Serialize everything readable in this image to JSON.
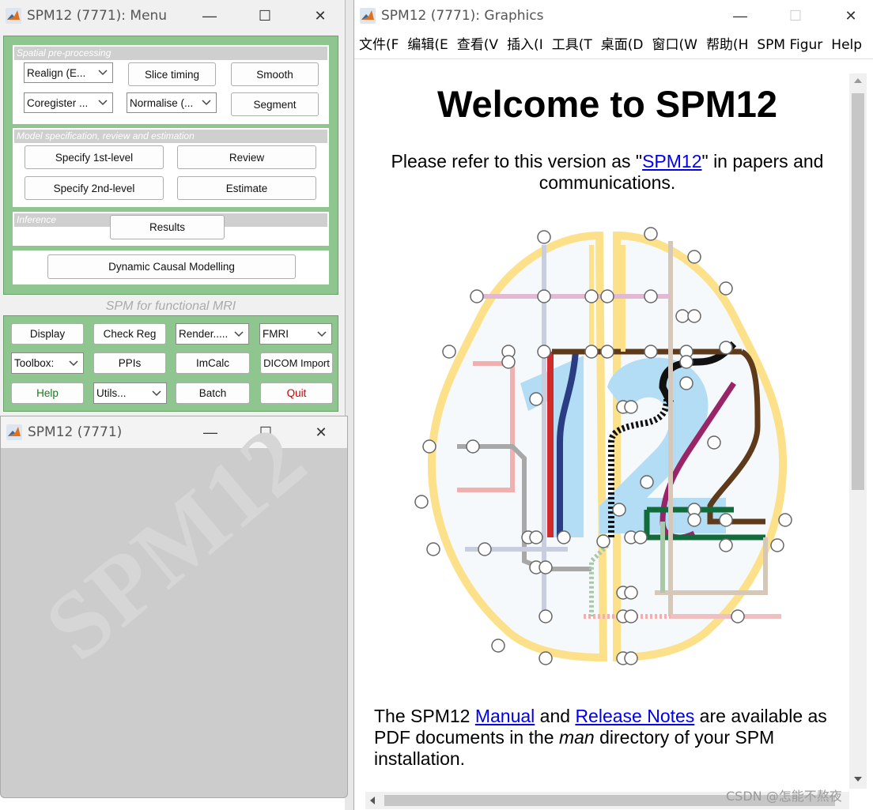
{
  "menu_window": {
    "title": "SPM12 (7771): Menu",
    "controls": {
      "minimize": "—",
      "maximize": "☐",
      "close": "✕"
    },
    "spatial_panel": {
      "label": "Spatial pre-processing",
      "realign": "Realign (E...",
      "slice_timing": "Slice timing",
      "smooth": "Smooth",
      "coregister": "Coregister ...",
      "normalise": "Normalise (...",
      "segment": "Segment"
    },
    "model_panel": {
      "label": "Model specification, review and estimation",
      "specify_1st": "Specify 1st-level",
      "review": "Review",
      "specify_2nd": "Specify 2nd-level",
      "estimate": "Estimate"
    },
    "inference_panel": {
      "label": "Inference",
      "results": "Results"
    },
    "dcm": "Dynamic Causal Modelling",
    "modality_caption": "SPM for functional MRI",
    "tools": {
      "display": "Display",
      "check_reg": "Check Reg",
      "render": "Render.....",
      "fmri": "FMRI",
      "toolbox": "Toolbox:",
      "ppis": "PPIs",
      "imcalc": "ImCalc",
      "dicom": "DICOM Import",
      "help": "Help",
      "utils": "Utils...",
      "batch": "Batch",
      "quit": "Quit"
    },
    "colors": {
      "panel_green": "#8fc58f",
      "help_text": "#1a7a1a",
      "quit_text": "#cc0000"
    }
  },
  "spm_window": {
    "title": "SPM12 (7771)",
    "watermark": "SPM12"
  },
  "graphics_window": {
    "title": "SPM12 (7771): Graphics",
    "menubar": [
      "文件(F",
      "编辑(E",
      "查看(V",
      "插入(I",
      "工具(T",
      "桌面(D",
      "窗口(W",
      "帮助(H",
      "SPM Figur",
      "Help"
    ],
    "heading": "Welcome to SPM12",
    "intro_before": "Please refer to this version as \"",
    "intro_link": "SPM12",
    "intro_after": "\" in papers and communications.",
    "footer_1": "The SPM12 ",
    "footer_manual": "Manual",
    "footer_and": " and ",
    "footer_release": "Release Notes",
    "footer_2": " are available as PDF documents in the ",
    "footer_man": "man",
    "footer_3": " directory of your SPM installation."
  },
  "watermark_csdn": "CSDN @怎能不熬夜"
}
